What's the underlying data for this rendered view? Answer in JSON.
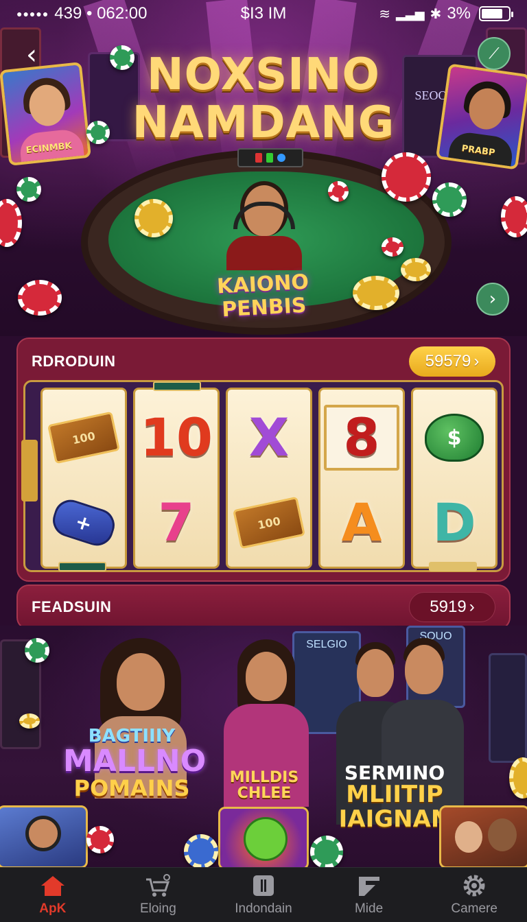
{
  "status_bar": {
    "left_text": "439 • 062:00",
    "center_text": "$I3 IM",
    "battery_text": "3%"
  },
  "hero": {
    "title_line1": "NOXSINO",
    "title_line2": "NAMDANG",
    "badge_line1": "KAIONO",
    "badge_line2": "PENBIS",
    "left_card_label": "ECINMBK",
    "right_card_label": "PRABP",
    "right_sign": "SEOONA",
    "back_icon": "chevron-left-icon",
    "top_right_icon": "wrench-icon",
    "next_icon": "chevron-right-icon"
  },
  "sections": {
    "first": {
      "title": "RDRODUIN",
      "value": "59579",
      "color": "#f2b52a"
    },
    "second": {
      "title": "FEADSUIN",
      "value": "5919",
      "color": "#6b1128"
    }
  },
  "reels": [
    {
      "top": "100",
      "bottom": "+"
    },
    {
      "top": "10",
      "bottom": "7"
    },
    {
      "top": "X",
      "bottom": "100"
    },
    {
      "top": "8",
      "bottom": "A"
    },
    {
      "top": "$",
      "bottom": "D"
    }
  ],
  "features": {
    "left_caption": [
      "BAGTIIIY",
      "MALLNO",
      "POMAINS"
    ],
    "middle_caption": [
      "MILLDIS",
      "CHLEE"
    ],
    "right_caption": [
      "SERMINO",
      "MLIITIP",
      "IAIGNAN"
    ],
    "sign_left": "SELGIO",
    "sign_right": "SOUO"
  },
  "bottom_nav": [
    {
      "label": "ApK",
      "icon": "home-icon",
      "active": true
    },
    {
      "label": "Eloing",
      "icon": "cart-icon",
      "active": false
    },
    {
      "label": "Indondain",
      "icon": "card-icon",
      "active": false
    },
    {
      "label": "Mide",
      "icon": "share-icon",
      "active": false
    },
    {
      "label": "Camere",
      "icon": "gear-icon",
      "active": false
    }
  ],
  "colors": {
    "accent_gold": "#f2b52a",
    "panel_maroon": "#7a1a36",
    "nav_active": "#e23a2a",
    "table_green": "#1f7a40"
  }
}
